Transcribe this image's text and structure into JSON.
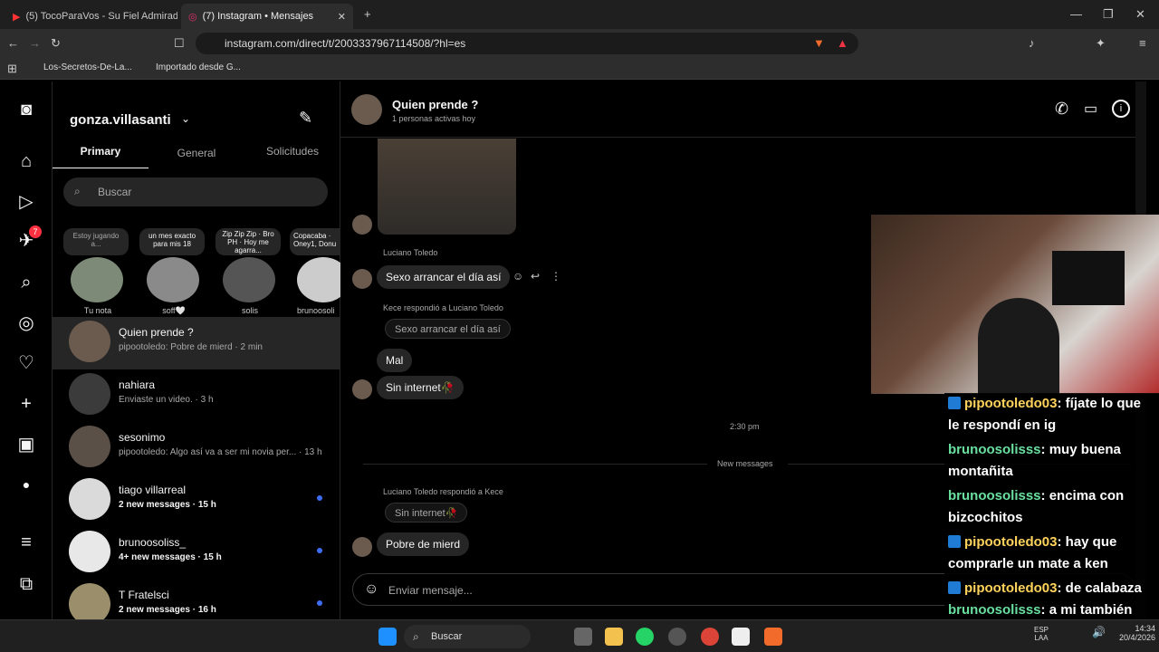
{
  "browser": {
    "tabs": [
      {
        "title": "(5) TocoParaVos - Su Fiel Admirad"
      },
      {
        "title": "(7) Instagram • Mensajes"
      }
    ],
    "url": "instagram.com/direct/t/2003337967114508/?hl=es",
    "bookmarks": [
      "Los-Secretos-De-La...",
      "Importado desde G..."
    ]
  },
  "nav": {
    "notif_count": "7"
  },
  "inbox": {
    "username": "gonza.villasanti",
    "tabs": [
      "Primary",
      "General",
      "Solicitudes"
    ],
    "search_placeholder": "Buscar",
    "notes": [
      {
        "note": "Estoy jugando a...",
        "name": "Tu nota"
      },
      {
        "note": "un mes exacto para mis 18",
        "name": "soff🤍"
      },
      {
        "note": "Zip Zip Zip · Bro PH · Hoy me agarra...",
        "name": "solis"
      },
      {
        "note": "Copacaba · Oney1, Donu",
        "name": "brunoosoli"
      }
    ],
    "threads": [
      {
        "name": "Quien prende ?",
        "preview": "pipootoledo: Pobre de mierd · 2 min",
        "unread": false
      },
      {
        "name": "nahiara",
        "preview": "Enviaste un video. · 3 h",
        "unread": false
      },
      {
        "name": "sesonimo",
        "preview": "pipootoledo: Algo así va a ser mi novia per... · 13 h",
        "unread": false
      },
      {
        "name": "tiago villarreal",
        "preview": "2 new messages · 15 h",
        "unread": true
      },
      {
        "name": "brunoosoliss_",
        "preview": "4+ new messages · 15 h",
        "unread": true
      },
      {
        "name": "T Fratelsci",
        "preview": "2 new messages · 16 h",
        "unread": true
      }
    ]
  },
  "chat": {
    "title": "Quien prende ?",
    "subtitle": "1 personas activas hoy",
    "sender1": "Luciano Toledo",
    "msg1": "Sexo arrancar el día así",
    "reply_label1": "Kece respondió a Luciano Toledo",
    "reply_quote1": "Sexo arrancar el día así",
    "msg2": "Mal",
    "msg3": "Sin internet🥀",
    "time": "2:30 pm",
    "new_messages": "New messages",
    "reply_label2": "Luciano Toledo respondió a Kece",
    "reply_quote2": "Sin internet🥀",
    "msg4": "Pobre de mierd",
    "input_placeholder": "Enviar mensaje..."
  },
  "stream_chat": [
    {
      "user": "pipootoledo03",
      "text": ": fíjate lo que le respondí en ig",
      "badge": true
    },
    {
      "user": "brunoosolisss",
      "text": ": muy buena montañita",
      "badge": false
    },
    {
      "user": "brunoosolisss",
      "text": ": encima con bizcochitos",
      "badge": false
    },
    {
      "user": "pipootoledo03",
      "text": ": hay que comprarle un mate a ken",
      "badge": true
    },
    {
      "user": "pipootoledo03",
      "text": ": de calabaza",
      "badge": true
    },
    {
      "user": "brunoosolisss",
      "text": ": a mi también",
      "badge": false
    }
  ],
  "taskbar": {
    "search": "Buscar",
    "lang1": "ESP",
    "lang2": "LAA",
    "clock": "14:34",
    "date": "20/4/2026"
  }
}
